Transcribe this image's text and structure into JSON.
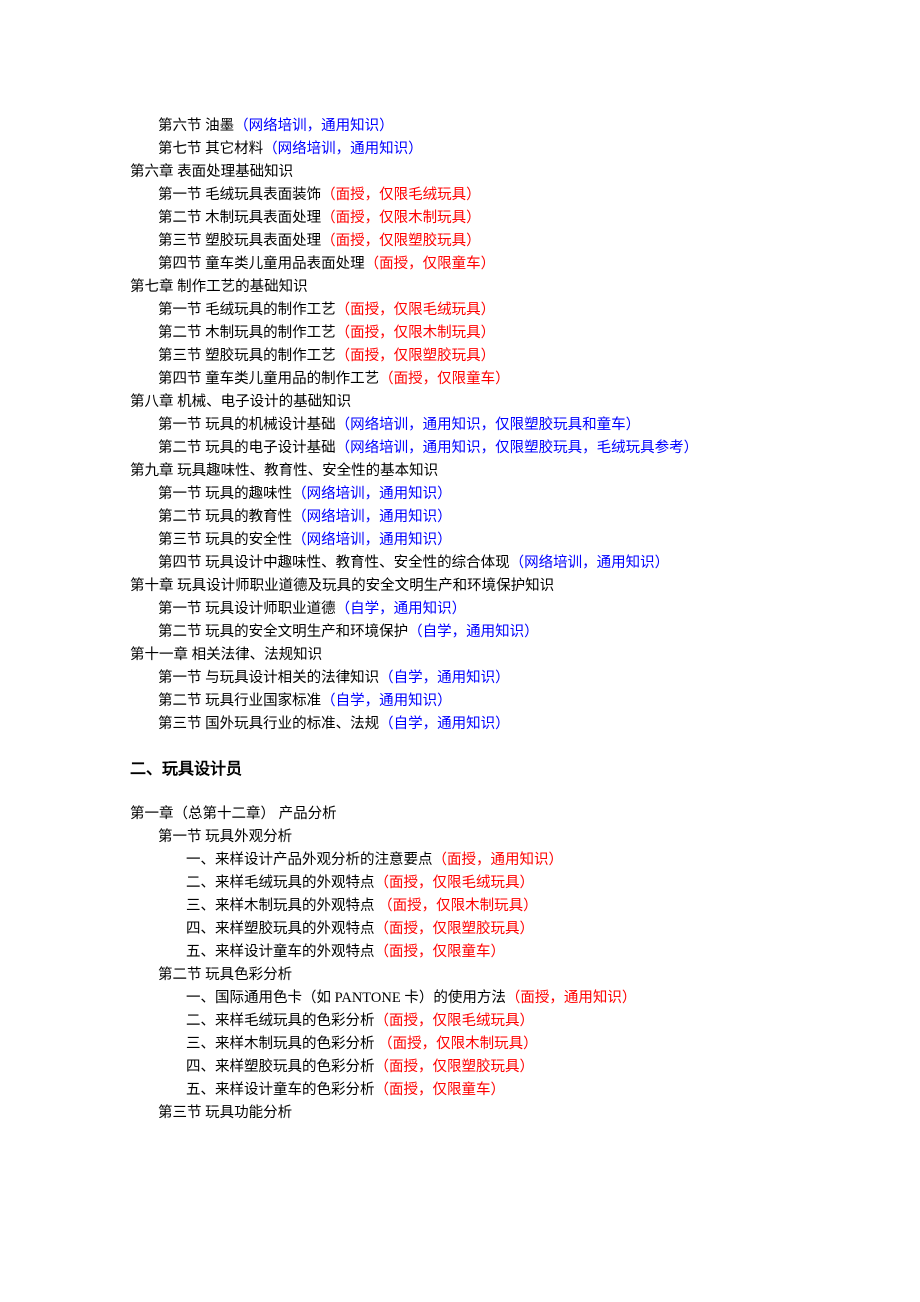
{
  "lines": [
    {
      "cls": "l1",
      "t": "第六节 油墨",
      "n": "（网络培训，通用知识）",
      "nc": "blue"
    },
    {
      "cls": "l1",
      "t": "第七节 其它材料",
      "n": "（网络培训，通用知识）",
      "nc": "blue"
    },
    {
      "cls": "l0",
      "t": "第六章 表面处理基础知识"
    },
    {
      "cls": "l1",
      "t": "第一节 毛绒玩具表面装饰",
      "n": "（面授，仅限毛绒玩具）",
      "nc": "red"
    },
    {
      "cls": "l1",
      "t": "第二节 木制玩具表面处理",
      "n": "（面授，仅限木制玩具）",
      "nc": "red"
    },
    {
      "cls": "l1",
      "t": "第三节 塑胶玩具表面处理",
      "n": "（面授，仅限塑胶玩具）",
      "nc": "red"
    },
    {
      "cls": "l1",
      "t": "第四节 童车类儿童用品表面处理",
      "n": "（面授，仅限童车）",
      "nc": "red"
    },
    {
      "cls": "l0",
      "t": "第七章 制作工艺的基础知识"
    },
    {
      "cls": "l1",
      "t": "第一节 毛绒玩具的制作工艺",
      "n": "（面授，仅限毛绒玩具）",
      "nc": "red"
    },
    {
      "cls": "l1",
      "t": "第二节 木制玩具的制作工艺",
      "n": "（面授，仅限木制玩具）",
      "nc": "red"
    },
    {
      "cls": "l1",
      "t": "第三节 塑胶玩具的制作工艺",
      "n": "（面授，仅限塑胶玩具）",
      "nc": "red"
    },
    {
      "cls": "l1",
      "t": "第四节 童车类儿童用品的制作工艺",
      "n": "（面授，仅限童车）",
      "nc": "red"
    },
    {
      "cls": "l0",
      "t": "第八章 机械、电子设计的基础知识"
    },
    {
      "cls": "l1",
      "t": "第一节 玩具的机械设计基础",
      "n": "（网络培训，通用知识，仅限塑胶玩具和童车）",
      "nc": "blue"
    },
    {
      "cls": "l1",
      "t": "第二节 玩具的电子设计基础",
      "n": "（网络培训，通用知识，仅限塑胶玩具，毛绒玩具参考）",
      "nc": "blue"
    },
    {
      "cls": "l0",
      "t": "第九章 玩具趣味性、教育性、安全性的基本知识"
    },
    {
      "cls": "l1",
      "t": "第一节 玩具的趣味性",
      "n": "（网络培训，通用知识）",
      "nc": "blue"
    },
    {
      "cls": "l1",
      "t": "第二节 玩具的教育性",
      "n": "（网络培训，通用知识）",
      "nc": "blue"
    },
    {
      "cls": "l1",
      "t": "第三节 玩具的安全性",
      "n": "（网络培训，通用知识）",
      "nc": "blue"
    },
    {
      "cls": "l1",
      "t": "第四节 玩具设计中趣味性、教育性、安全性的综合体现",
      "n": "（网络培训，通用知识）",
      "nc": "blue"
    },
    {
      "cls": "l0",
      "t": "第十章 玩具设计师职业道德及玩具的安全文明生产和环境保护知识"
    },
    {
      "cls": "l1",
      "t": "第一节 玩具设计师职业道德",
      "n": "（自学，通用知识）",
      "nc": "blue"
    },
    {
      "cls": "l1",
      "t": "第二节 玩具的安全文明生产和环境保护",
      "n": "（自学，通用知识）",
      "nc": "blue"
    },
    {
      "cls": "l0",
      "t": "第十一章 相关法律、法规知识"
    },
    {
      "cls": "l1",
      "t": "第一节 与玩具设计相关的法律知识",
      "n": "（自学，通用知识）",
      "nc": "blue"
    },
    {
      "cls": "l1",
      "t": "第二节 玩具行业国家标准",
      "n": "（自学，通用知识）",
      "nc": "blue"
    },
    {
      "cls": "l1",
      "t": "第三节 国外玩具行业的标准、法规",
      "n": "（自学，通用知识）",
      "nc": "blue"
    }
  ],
  "heading2": "二、玩具设计员",
  "lines2": [
    {
      "cls": "l0",
      "t": "第一章（总第十二章） 产品分析"
    },
    {
      "cls": "l1",
      "t": "第一节 玩具外观分析"
    },
    {
      "cls": "l2",
      "t": "一、来样设计产品外观分析的注意要点",
      "n": "（面授，通用知识）",
      "nc": "red"
    },
    {
      "cls": "l2",
      "t": "二、来样毛绒玩具的外观特点",
      "n": "（面授，仅限毛绒玩具）",
      "nc": "red"
    },
    {
      "cls": "l2",
      "t": "三、来样木制玩具的外观特点 ",
      "n": "（面授，仅限木制玩具）",
      "nc": "red"
    },
    {
      "cls": "l2",
      "t": "四、来样塑胶玩具的外观特点",
      "n": "（面授，仅限塑胶玩具）",
      "nc": "red"
    },
    {
      "cls": "l2",
      "t": "五、来样设计童车的外观特点",
      "n": "（面授，仅限童车）",
      "nc": "red"
    },
    {
      "cls": "l1",
      "t": "第二节 玩具色彩分析"
    },
    {
      "cls": "l2",
      "t": "一、国际通用色卡（如 PANTONE 卡）的使用方法",
      "n": "（面授，通用知识）",
      "nc": "red"
    },
    {
      "cls": "l2",
      "t": "二、来样毛绒玩具的色彩分析",
      "n": "（面授，仅限毛绒玩具）",
      "nc": "red"
    },
    {
      "cls": "l2",
      "t": "三、来样木制玩具的色彩分析 ",
      "n": "（面授，仅限木制玩具）",
      "nc": "red"
    },
    {
      "cls": "l2",
      "t": "四、来样塑胶玩具的色彩分析",
      "n": "（面授，仅限塑胶玩具）",
      "nc": "red"
    },
    {
      "cls": "l2",
      "t": "五、来样设计童车的色彩分析",
      "n": "（面授，仅限童车）",
      "nc": "red"
    },
    {
      "cls": "l1",
      "t": "第三节 玩具功能分析"
    }
  ]
}
